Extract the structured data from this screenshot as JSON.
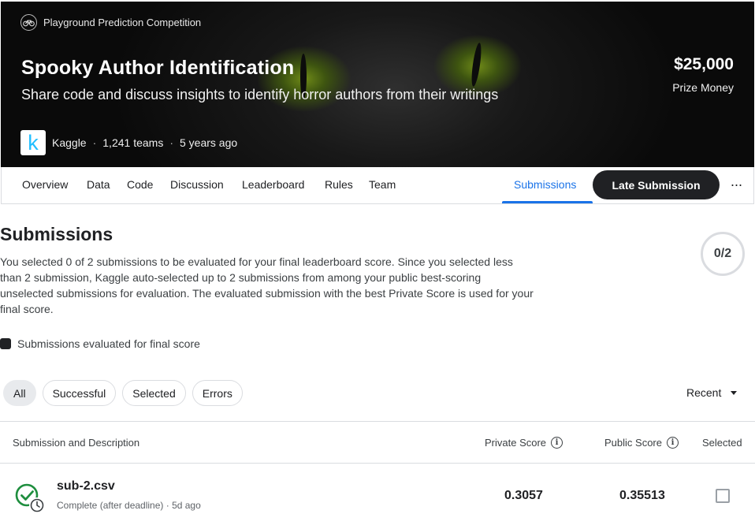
{
  "hero": {
    "type_label": "Playground Prediction Competition",
    "title": "Spooky Author Identification",
    "subtitle": "Share code and discuss insights to identify horror authors from their writings",
    "host": "Kaggle",
    "host_logo_letter": "k",
    "teams": "1,241 teams",
    "age": "5 years ago",
    "separator": "·",
    "prize_amount": "$25,000",
    "prize_label": "Prize Money"
  },
  "nav": {
    "tabs": [
      "Overview",
      "Data",
      "Code",
      "Discussion",
      "Leaderboard",
      "Rules",
      "Team"
    ],
    "active_tab": "Submissions",
    "late_submission_label": "Late Submission",
    "more_label": "···"
  },
  "submissions": {
    "title": "Submissions",
    "description": "You selected 0 of 2 submissions to be evaluated for your final leaderboard score. Since you selected less than 2 submission, Kaggle auto-selected up to 2 submissions from among your public best-scoring unselected submissions for evaluation. The evaluated submission with the best Private Score is used for your final score.",
    "counter": "0/2",
    "legend_label": "Submissions evaluated for final score",
    "filters": [
      "All",
      "Successful",
      "Selected",
      "Errors"
    ],
    "active_filter": "All",
    "sort_label": "Recent"
  },
  "table": {
    "headers": {
      "submission": "Submission and Description",
      "private": "Private Score",
      "public": "Public Score",
      "selected": "Selected"
    },
    "info_glyph": "i",
    "rows": [
      {
        "file": "sub-2.csv",
        "status": "Complete (after deadline) · 5d ago",
        "private_score": "0.3057",
        "public_score": "0.35513",
        "selected": false
      }
    ]
  },
  "colors": {
    "accent": "#1a73e8",
    "success": "#1e8e3e",
    "kaggle_blue": "#20beff",
    "dark_button": "#202124"
  },
  "icons": {
    "competition_type": "bike-icon",
    "status": "check-clock-icon",
    "info": "info-icon",
    "sort": "caret-down-icon"
  }
}
